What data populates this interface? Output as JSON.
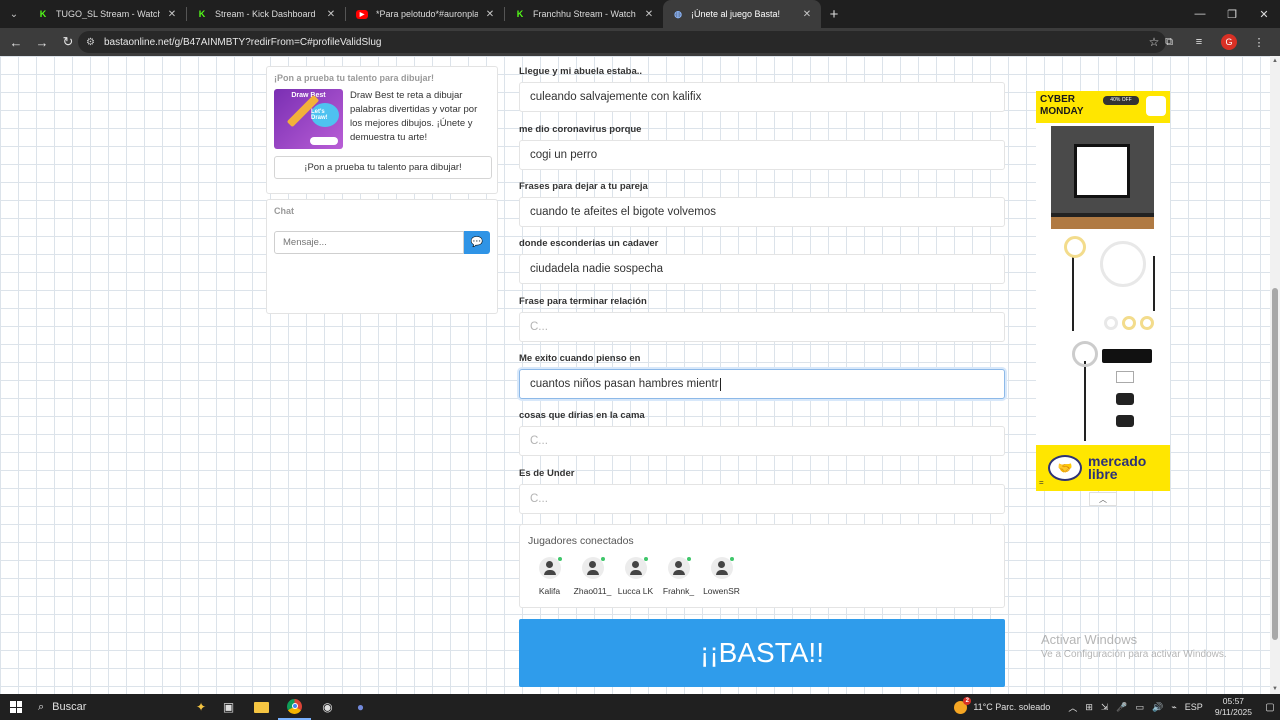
{
  "browser": {
    "tabs": [
      {
        "title": "TUGO_SL Stream - Watch Live o",
        "favicon": "kick-icon",
        "active": false
      },
      {
        "title": "Stream - Kick Dashboard",
        "favicon": "kick-icon",
        "active": false
      },
      {
        "title": "*Para pelotudo*#auronplay #t",
        "favicon": "youtube-icon",
        "active": false
      },
      {
        "title": "Franchhu Stream - Watch Live o",
        "favicon": "kick-icon",
        "active": false
      },
      {
        "title": "¡Únete al juego Basta!",
        "favicon": "globe-icon",
        "active": true
      }
    ],
    "url": "bastaonline.net/g/B47AINMBTY?redirFrom=C#profileValidSlug",
    "profile_initial": "G"
  },
  "promo": {
    "heading": "¡Pon a prueba tu talento para dibujar!",
    "thumb_title": "Draw Best",
    "thumb_bubble": "Let's Draw!",
    "description": "Draw Best te reta a dibujar palabras divertidas y votar por los mejores dibujos. ¡Únete y demuestra tu arte!",
    "button_label": "¡Pon a prueba tu talento para dibujar!"
  },
  "chat": {
    "heading": "Chat",
    "placeholder": "Mensaje..."
  },
  "form": {
    "fields": [
      {
        "label": "Llegue y mi abuela estaba..",
        "value": "culeando salvajemente con kalifix",
        "placeholder": ""
      },
      {
        "label": "me dio coronavirus porque",
        "value": "cogi un perro",
        "placeholder": ""
      },
      {
        "label": "Frases para dejar a tu pareja",
        "value": "cuando te afeites el bigote volvemos",
        "placeholder": ""
      },
      {
        "label": "donde esconderias un cadaver",
        "value": "ciudadela nadie sospecha",
        "placeholder": ""
      },
      {
        "label": "Frase para terminar relación",
        "value": "",
        "placeholder": "C..."
      },
      {
        "label": "Me exito cuando pienso en",
        "value": "cuantos niños pasan hambres mientr",
        "placeholder": ""
      },
      {
        "label": "cosas que dirias en la cama",
        "value": "",
        "placeholder": "C..."
      },
      {
        "label": "Es de Under",
        "value": "",
        "placeholder": "C..."
      }
    ]
  },
  "players": {
    "heading": "Jugadores conectados",
    "list": [
      "Kalifa",
      "Zhao011_",
      "Lucca LK",
      "Frahnk_",
      "LowenSR"
    ]
  },
  "basta_button": "¡¡BASTA!!",
  "ad": {
    "headline_1": "CYBER",
    "headline_2": "MONDAY",
    "badge": "40% OFF",
    "brand_1": "mercado",
    "brand_2": "libre",
    "eq_icon": "="
  },
  "watermark": {
    "line1": "Activar Windows",
    "line2": "Ve a Configuración para activar Windows."
  },
  "taskbar": {
    "search_label": "Buscar",
    "weather": "11°C  Parc. soleado",
    "weather_badge": "2",
    "language": "ESP",
    "time": "05:57",
    "date": "9/11/2025"
  }
}
